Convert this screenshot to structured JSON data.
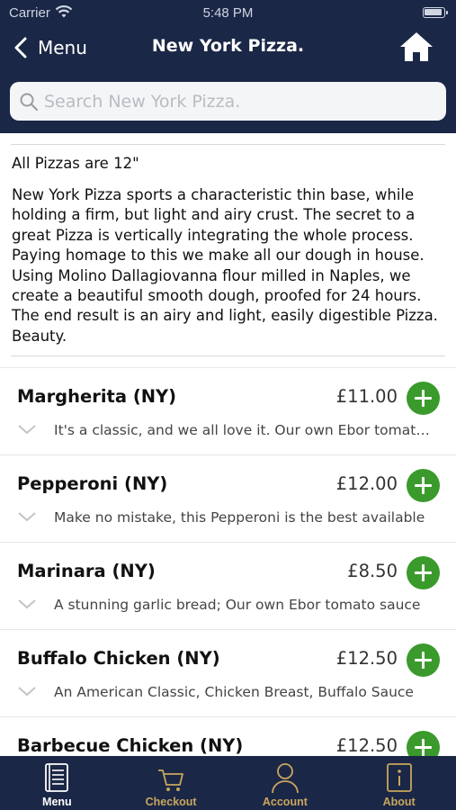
{
  "status_bar": {
    "carrier": "Carrier",
    "time": "5:48 PM"
  },
  "nav": {
    "back_label": "Menu",
    "title": "New York Pizza."
  },
  "search": {
    "placeholder": "Search New York Pizza."
  },
  "intro": {
    "title": "All Pizzas are 12\"",
    "text": "New York Pizza sports a characteristic thin base, while holding a firm, but light and airy crust. The secret to a great Pizza is vertically integrating the whole process. Paying homage to this we make all our dough in house. Using Molino Dallagiovanna flour milled in Naples, we create a beautiful smooth dough, proofed for 24 hours. The end result is an airy and light, easily digestible Pizza. Beauty."
  },
  "items": [
    {
      "name": "Margherita (NY)",
      "price": "£11.00",
      "description": "It's a classic, and we all love it. Our own Ebor tomato sauce"
    },
    {
      "name": "Pepperoni (NY)",
      "price": "£12.00",
      "description": "Make no mistake, this Pepperoni is the best available"
    },
    {
      "name": "Marinara (NY)",
      "price": "£8.50",
      "description": "A stunning garlic bread; Our own Ebor tomato sauce"
    },
    {
      "name": "Buffalo Chicken (NY)",
      "price": "£12.50",
      "description": "An American Classic, Chicken Breast, Buffalo Sauce"
    },
    {
      "name": "Barbecue Chicken (NY)",
      "price": "£12.50",
      "description": ""
    }
  ],
  "tabs": [
    {
      "label": "Menu",
      "icon": "menu-book-icon",
      "active": true
    },
    {
      "label": "Checkout",
      "icon": "cart-icon",
      "active": false
    },
    {
      "label": "Account",
      "icon": "person-icon",
      "active": false
    },
    {
      "label": "About",
      "icon": "info-icon",
      "active": false
    }
  ],
  "colors": {
    "header": "#1b2746",
    "accent_green": "#3a9a2b",
    "tab_inactive": "#c8a75e"
  }
}
